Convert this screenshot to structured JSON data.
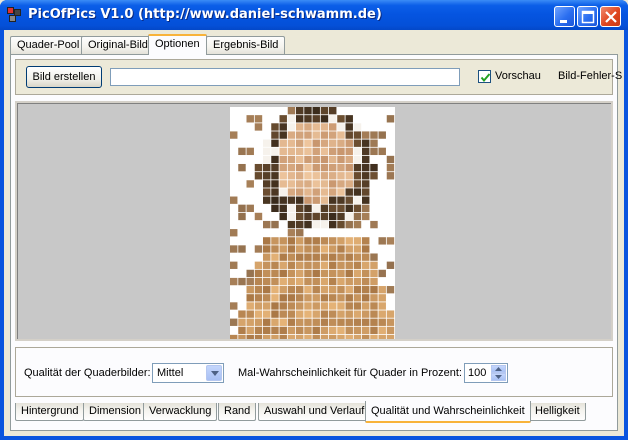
{
  "window": {
    "title": "PicOfPics V1.0 (http://www.daniel-schwamm.de)",
    "minimize_label": "_",
    "maximize_label": "□",
    "close_label": "✕"
  },
  "top_tabs": [
    {
      "label": "Quader-Pool",
      "active": false
    },
    {
      "label": "Original-Bild",
      "active": false
    },
    {
      "label": "Optionen",
      "active": true
    },
    {
      "label": "Ergebnis-Bild",
      "active": false
    }
  ],
  "toolbar": {
    "create_button": "Bild erstellen",
    "path_value": "",
    "preview_label": "Vorschau",
    "preview_checked": true,
    "error_label": "Bild-Fehler-S"
  },
  "options": {
    "quality_label": "Qualität der Quaderbilder:",
    "quality_value": "Mittel",
    "probability_label": "Mal-Wahrscheinlichkeit für Quader in Prozent:",
    "probability_value": "100"
  },
  "bottom_tabs": [
    {
      "label": "Hintergrund",
      "active": false
    },
    {
      "label": "Dimension",
      "active": false
    },
    {
      "label": "Verwacklung",
      "active": false
    },
    {
      "label": "Rand",
      "active": false
    },
    {
      "label": "Auswahl und Verlauf",
      "active": false
    },
    {
      "label": "Qualität und Wahrscheinlichkeit",
      "active": true
    },
    {
      "label": "Helligkeit",
      "active": false
    }
  ],
  "colors": {
    "titlebar": "#0554e0",
    "active_tab_accent": "#f8b33a",
    "viewport_bg": "#c8c8c8"
  }
}
